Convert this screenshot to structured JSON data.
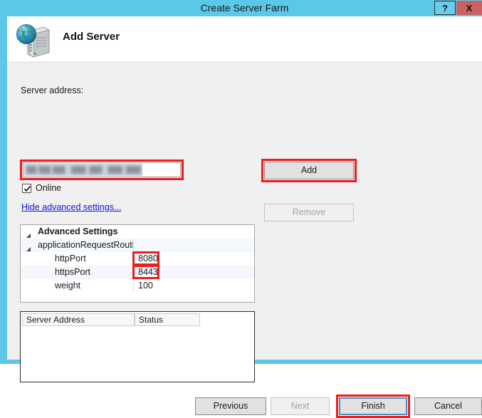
{
  "window": {
    "title": "Create Server Farm",
    "help_label": "?",
    "close_label": "X",
    "accent_color": "#5bc8e8",
    "annotation_color": "#ef1c1c"
  },
  "header": {
    "icon": "server-globe-icon",
    "title": "Add Server"
  },
  "form": {
    "server_address_label": "Server address:",
    "server_address_value": "",
    "server_address_placeholder": "",
    "online_label": "Online",
    "online_checked": true,
    "advanced_link_label": "Hide advanced settings..."
  },
  "advanced_settings": {
    "rows": [
      {
        "name": "Advanced Settings",
        "value": "",
        "indent": 0,
        "bold": true,
        "expander": true,
        "shaded": false
      },
      {
        "name": "applicationRequestRouti",
        "value": "",
        "indent": 1,
        "bold": false,
        "expander": true,
        "shaded": true
      },
      {
        "name": "httpPort",
        "value": "8080",
        "indent": 2,
        "bold": false,
        "expander": false,
        "shaded": false
      },
      {
        "name": "httpsPort",
        "value": "8443",
        "indent": 2,
        "bold": false,
        "expander": false,
        "shaded": true
      },
      {
        "name": "weight",
        "value": "100",
        "indent": 2,
        "bold": false,
        "expander": false,
        "shaded": false
      }
    ]
  },
  "server_list": {
    "columns": [
      "Server Address",
      "Status"
    ],
    "rows": []
  },
  "buttons": {
    "add": "Add",
    "remove": "Remove",
    "previous": "Previous",
    "next": "Next",
    "finish": "Finish",
    "cancel": "Cancel"
  }
}
